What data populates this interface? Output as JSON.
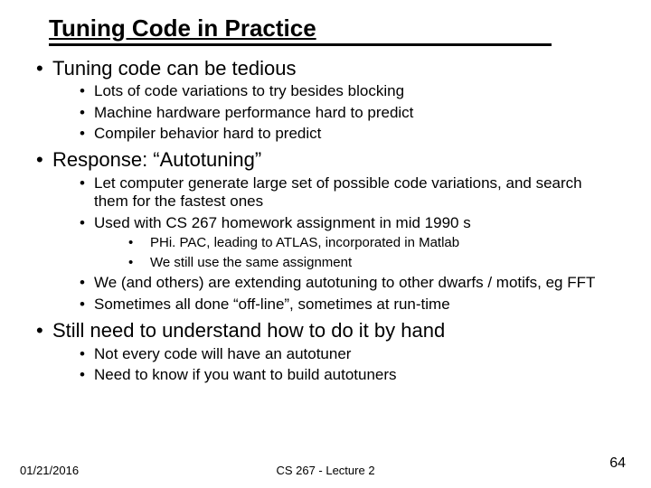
{
  "title": "Tuning Code in Practice",
  "bullets": {
    "b1": "Tuning code can be tedious",
    "b1_1": "Lots of code variations to try besides blocking",
    "b1_2": "Machine hardware performance hard to predict",
    "b1_3": "Compiler behavior hard to predict",
    "b2": "Response: “Autotuning”",
    "b2_1": "Let computer generate large set of possible code variations, and search them for the fastest ones",
    "b2_2": "Used with CS 267 homework assignment in mid 1990 s",
    "b2_2_1": "PHi. PAC, leading to ATLAS, incorporated in Matlab",
    "b2_2_2": "We still use the same assignment",
    "b2_3": "We (and others) are extending autotuning to other dwarfs / motifs, eg FFT",
    "b2_4": "Sometimes all done “off-line”, sometimes at run-time",
    "b3": "Still need to understand how to do it by hand",
    "b3_1": "Not every code will have an autotuner",
    "b3_2": "Need to know if you want to build autotuners"
  },
  "footer": {
    "date": "01/21/2016",
    "center": "CS 267 - Lecture 2",
    "page": "64"
  }
}
